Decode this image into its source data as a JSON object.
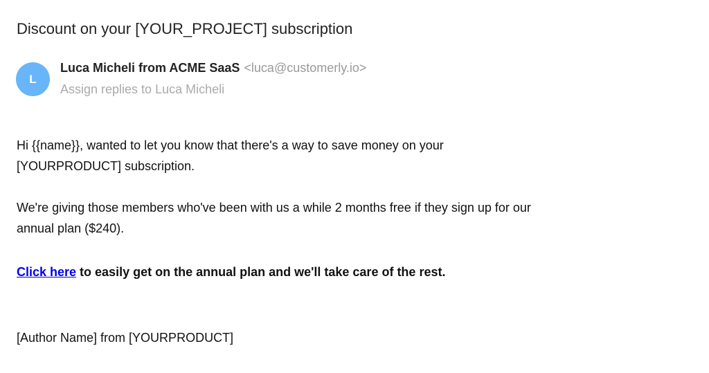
{
  "email": {
    "subject": "Discount on your [YOUR_PROJECT] subscription",
    "sender": {
      "avatar_initial": "L",
      "name": "Luca Micheli from ACME SaaS",
      "email": "<luca@customerly.io>",
      "assign_action": "Assign replies to Luca Micheli"
    },
    "body": {
      "paragraph1_line1": "Hi {{name}}, wanted to let you know that there's a way to save money on your",
      "paragraph1_line2": "[YOURPRODUCT] subscription.",
      "paragraph2_line1": "We're giving those members who've been with us a while 2 months free if they sign up for our",
      "paragraph2_line2": "annual plan ($240).",
      "cta_link": "Click here",
      "cta_rest": " to easily get on the annual plan and we'll take care of the rest.",
      "signature": "[Author Name] from [YOURPRODUCT]"
    }
  },
  "colors": {
    "avatar_bg": "#69b5f9",
    "link": "#0000ee",
    "muted_text": "#aaaaaa"
  }
}
